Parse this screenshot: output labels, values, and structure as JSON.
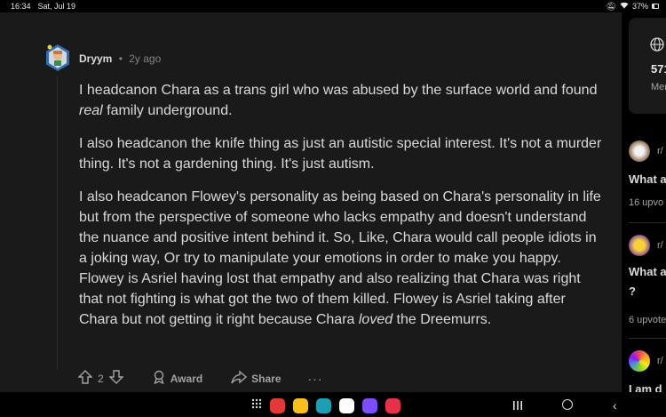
{
  "status_bar": {
    "time": "16:34",
    "date": "Sat, Jul 19",
    "battery": "37%"
  },
  "comment": {
    "author": "Dryym",
    "separator": "•",
    "age": "2y ago",
    "paragraphs": {
      "p1": {
        "a": "I headcanon Chara as a trans girl who was abused by the surface world and found ",
        "em": "real",
        "b": " family underground."
      },
      "p2": "I also headcanon the knife thing as just an autistic special interest. It's not a murder thing. It's not a gardening thing. It's just autism.",
      "p3": {
        "a": "I also headcanon Flowey's personality as being based on Chara's personality in life but from the perspective of someone who lacks empathy and doesn't understand the nuance and positive intent behind it. So, Like, Chara would call people idiots in a joking way, Or try to manipulate your emotions in order to make you happy. Flowey is Asriel having lost that empathy and also realizing that Chara was right that not fighting is what got the two of them killed. Flowey is Asriel taking after Chara but not getting it right because Chara ",
        "em": "loved",
        "b": " the Dreemurrs."
      }
    },
    "actions": {
      "vote_count": "2",
      "award_label": "Award",
      "share_label": "Share",
      "more_label": "···"
    }
  },
  "sidebar": {
    "member_count": "571",
    "member_label": "Mem",
    "posts": [
      {
        "sub": "r/",
        "title": "What a",
        "meta": "16 upvo"
      },
      {
        "sub": "r/",
        "title": "What a",
        "title2": "?",
        "meta": "6 upvote"
      },
      {
        "sub": "r/",
        "title": "I am d"
      }
    ]
  },
  "colors": {
    "background": "#1a1a1b",
    "text": "#d7dadc",
    "muted": "#818384"
  }
}
